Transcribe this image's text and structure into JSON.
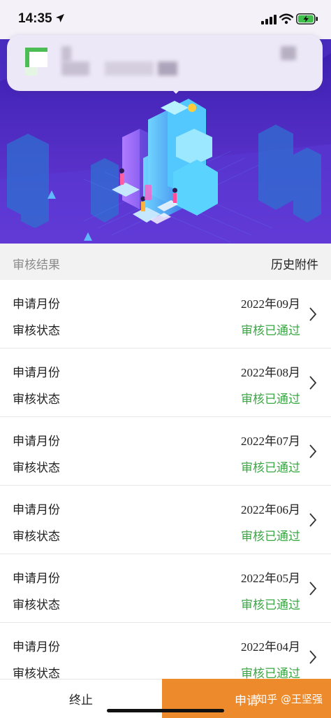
{
  "status_bar": {
    "time": "14:35"
  },
  "section": {
    "title": "审核结果",
    "history_link": "历史附件"
  },
  "records": [
    {
      "label_month": "申请月份",
      "month": "2022年09月",
      "label_status": "审核状态",
      "status": "审核已通过"
    },
    {
      "label_month": "申请月份",
      "month": "2022年08月",
      "label_status": "审核状态",
      "status": "审核已通过"
    },
    {
      "label_month": "申请月份",
      "month": "2022年07月",
      "label_status": "审核状态",
      "status": "审核已通过"
    },
    {
      "label_month": "申请月份",
      "month": "2022年06月",
      "label_status": "审核状态",
      "status": "审核已通过"
    },
    {
      "label_month": "申请月份",
      "month": "2022年05月",
      "label_status": "审核状态",
      "status": "审核已通过"
    },
    {
      "label_month": "申请月份",
      "month": "2022年04月",
      "label_status": "审核状态",
      "status": "审核已通过"
    }
  ],
  "actions": {
    "stop_label": "终止",
    "apply_label": "申请",
    "watermark": "知乎 @王坚强"
  },
  "colors": {
    "approved": "#39a843",
    "apply_button": "#ec8a2c",
    "banner_bg": "#4b2cc6"
  }
}
